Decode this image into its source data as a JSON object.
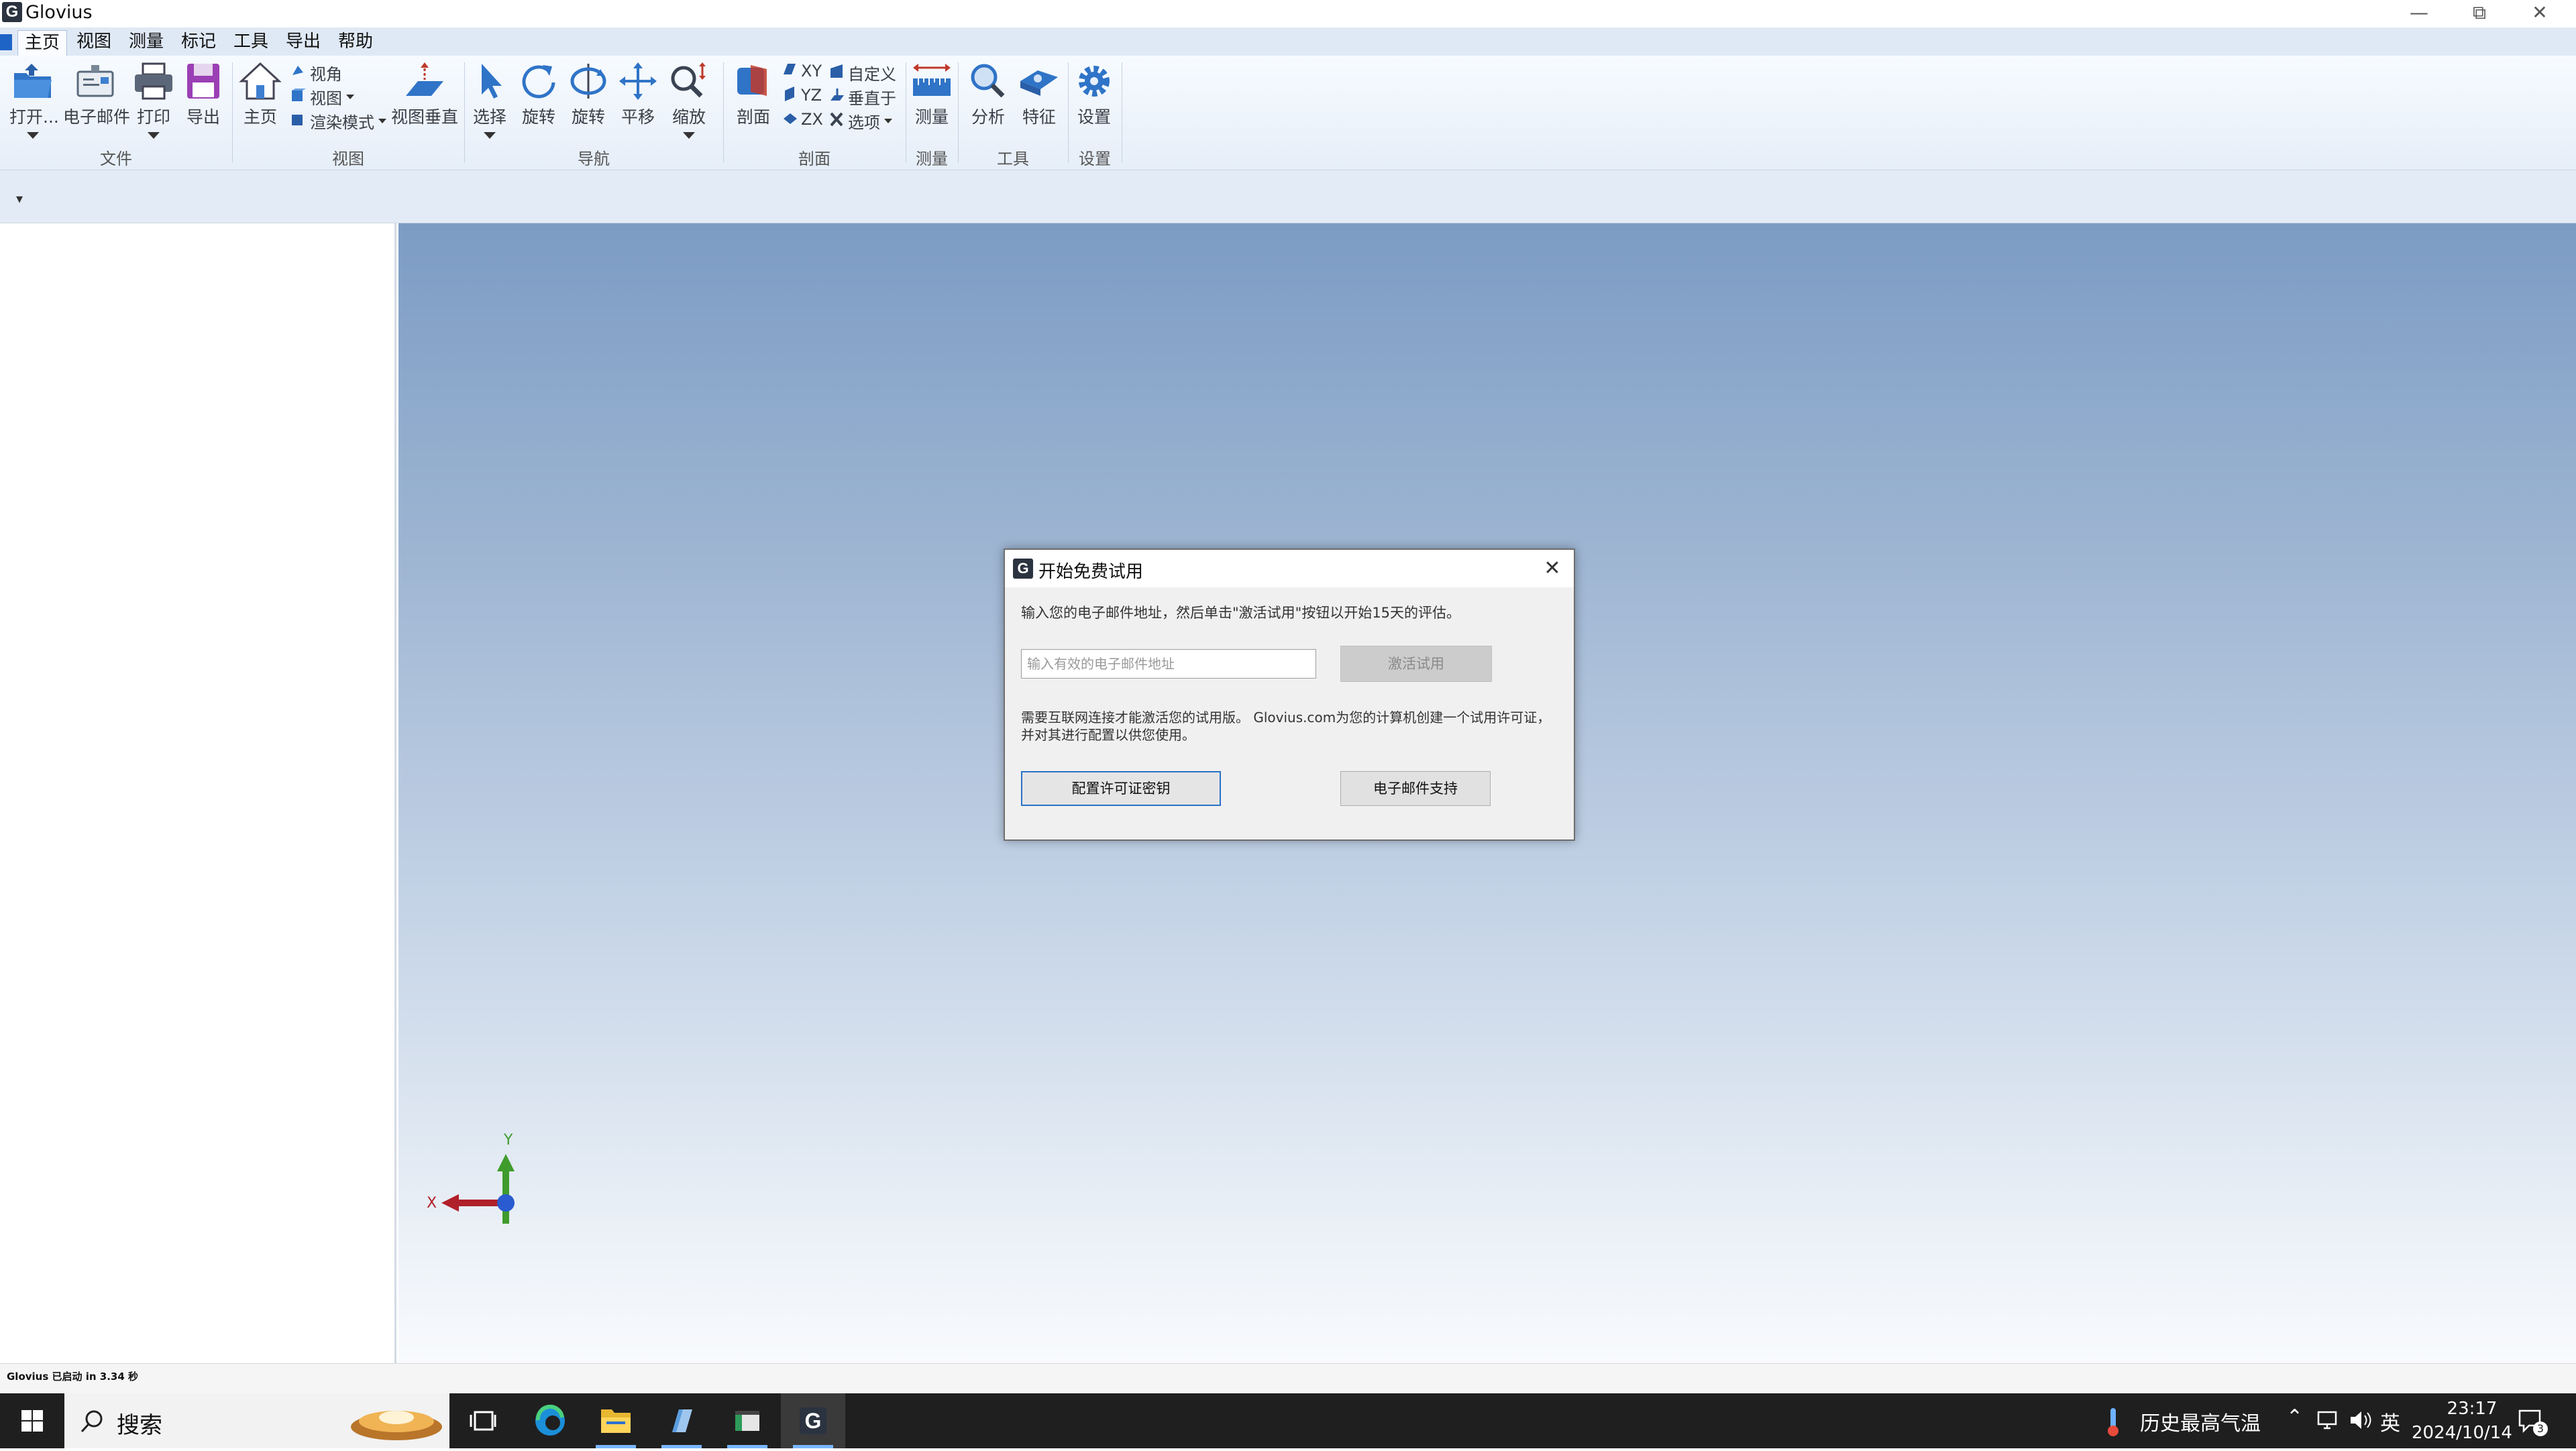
{
  "window": {
    "title": "Glovius",
    "logo_letter": "G"
  },
  "menu": {
    "items": [
      "主页",
      "视图",
      "测量",
      "标记",
      "工具",
      "导出",
      "帮助"
    ],
    "active_index": 0
  },
  "ribbon": {
    "file": {
      "open": "打开...",
      "email": "电子邮件",
      "print": "打印",
      "export": "导出",
      "group": "文件"
    },
    "view": {
      "home": "主页",
      "angle": "视角",
      "view": "视图",
      "render_mode": "渲染模式",
      "normal_view": "视图垂直",
      "group": "视图"
    },
    "navigation": {
      "select": "选择",
      "rotate": "旋转",
      "rotate2": "旋转",
      "pan": "平移",
      "zoom": "缩放",
      "group": "导航"
    },
    "section": {
      "section": "剖面",
      "xy": "XY",
      "yz": "YZ",
      "zx": "ZX",
      "custom": "自定义",
      "perpendicular": "垂直于",
      "options": "选项",
      "group": "剖面"
    },
    "measure": {
      "measure": "测量",
      "group": "测量"
    },
    "tools": {
      "analyze": "分析",
      "feature": "特征",
      "group": "工具"
    },
    "settings": {
      "settings": "设置",
      "group": "设置"
    }
  },
  "axes": {
    "x": "X",
    "y": "Y",
    "x_color": "#b0202a",
    "y_color": "#3f9c2c",
    "z_color": "#2a5bd0"
  },
  "status": {
    "text": "Glovius 已启动 in 3.34 秒"
  },
  "dialog": {
    "title": "开始免费试用",
    "instruction": "输入您的电子邮件地址，然后单击\"激活试用\"按钮以开始15天的评估。",
    "email_placeholder": "输入有效的电子邮件地址",
    "email_value": "",
    "activate_label": "激活试用",
    "note_line1": "需要互联网连接才能激活您的试用版。 Glovius.com为您的计算机创建一个试用许可证，",
    "note_line2": "并对其进行配置以供您使用。",
    "license_label": "配置许可证密钥",
    "support_label": "电子邮件支持"
  },
  "taskbar": {
    "search_label": "搜索",
    "weather_label": "历史最高气温",
    "lang": "英",
    "time": "23:17",
    "date": "2024/10/14",
    "notification_count": "3"
  },
  "colors": {
    "accent": "#1e63c6",
    "ribbon_bg": "#e6eef8",
    "viewport_top": "#7c9cc4",
    "taskbar": "#1f1f1f"
  }
}
